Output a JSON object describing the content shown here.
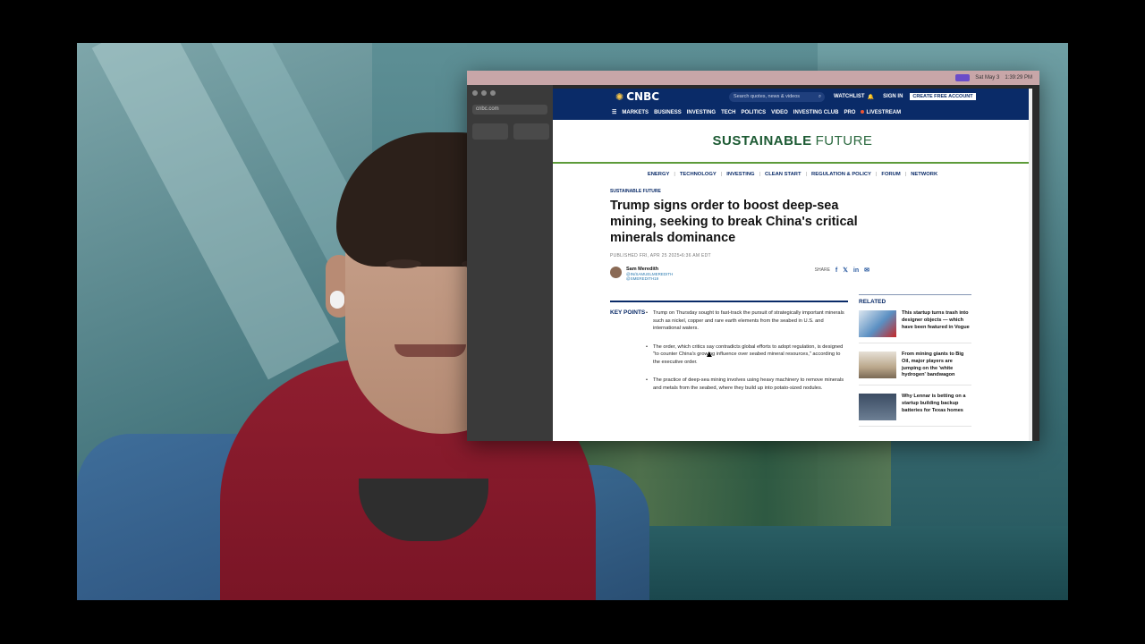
{
  "menubar": {
    "date": "Sat May 3",
    "time": "1:39:29 PM"
  },
  "sidebar": {
    "url": "cnbc.com"
  },
  "cnbc": {
    "logo": "CNBC",
    "search_placeholder": "Search quotes, news & videos",
    "watchlist": "WATCHLIST",
    "sign_in": "SIGN IN",
    "create_account": "CREATE FREE ACCOUNT",
    "nav": [
      "MARKETS",
      "BUSINESS",
      "INVESTING",
      "TECH",
      "POLITICS",
      "VIDEO",
      "INVESTING CLUB",
      "PRO",
      "LIVESTREAM"
    ]
  },
  "section": {
    "brand_bold": "SUSTAINABLE",
    "brand_light": "FUTURE"
  },
  "subnav": [
    "ENERGY",
    "TECHNOLOGY",
    "INVESTING",
    "CLEAN START",
    "REGULATION & POLICY",
    "FORUM",
    "NETWORK"
  ],
  "article": {
    "eyebrow": "SUSTAINABLE FUTURE",
    "headline": "Trump signs order to boost deep-sea mining, seeking to break China's critical minerals dominance",
    "published": "PUBLISHED FRI, APR 25 2025•6:36 AM EDT",
    "author": "Sam Meredith",
    "handle1": "@IN/SAMUELMEREDITH",
    "handle2": "@SMEREDITH19",
    "share_label": "SHARE",
    "key_points_label": "KEY POINTS",
    "key_points": [
      "Trump on Thursday sought to fast-track the pursuit of strategically important minerals such as nickel, copper and rare earth elements from the seabed in U.S. and international waters.",
      "The order, which critics say contradicts global efforts to adopt regulation, is designed \"to counter China's growing influence over seabed mineral resources,\" according to the executive order.",
      "The practice of deep-sea mining involves using heavy machinery to remove minerals and metals from the seabed, where they build up into potato-sized nodules."
    ]
  },
  "related": {
    "title": "RELATED",
    "items": [
      "This startup turns trash into designer objects — which have been featured in Vogue",
      "From mining giants to Big Oil, major players are jumping on the 'white hydrogen' bandwagon",
      "Why Lennar is betting on a startup building backup batteries for Texas homes"
    ]
  },
  "colors": {
    "cnbc_navy": "#0a2b68",
    "brand_green": "#1c5a33",
    "accent_green": "#5d9b3a"
  }
}
